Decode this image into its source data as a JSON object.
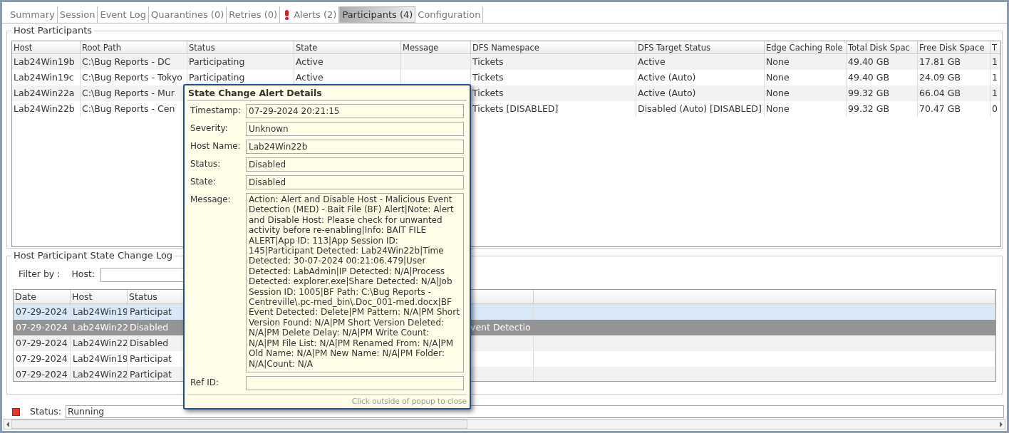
{
  "tabs": [
    {
      "label": "Summary",
      "selected": false
    },
    {
      "label": "Session",
      "selected": false
    },
    {
      "label": "Event Log",
      "selected": false
    },
    {
      "label": "Quarantines (0)",
      "selected": false
    },
    {
      "label": "Retries (0)",
      "selected": false
    },
    {
      "label": "Alerts (2)",
      "selected": false,
      "alert": true
    },
    {
      "label": "Participants (4)",
      "selected": true
    },
    {
      "label": "Configuration",
      "selected": false
    }
  ],
  "host_participants": {
    "title": "Host Participants",
    "columns": [
      "Host",
      "Root Path",
      "Status",
      "State",
      "Message",
      "DFS Namespace",
      "DFS Target Status",
      "Edge Caching Role",
      "Total Disk Spac",
      "Free Disk Space",
      "T"
    ],
    "rows": [
      {
        "host": "Lab24Win19b",
        "root_path": "C:\\Bug Reports - DC",
        "status": "Participating",
        "state": "Active",
        "dfs_namespace": "Tickets",
        "dfs_target_status": "Active",
        "edge_caching_role": "None",
        "total_disk_space": "49.40 GB",
        "free_disk_space": "17.81 GB",
        "column_11": "1"
      },
      {
        "host": "Lab24Win19c",
        "root_path": "C:\\Bug Reports - Tokyo",
        "status": "Participating",
        "state": "Active",
        "dfs_namespace": "Tickets",
        "dfs_target_status": "Active (Auto)",
        "edge_caching_role": "None",
        "total_disk_space": "49.40 GB",
        "free_disk_space": "24.09 GB",
        "column_11": "1"
      },
      {
        "host": "Lab24Win22a",
        "root_path": "C:\\Bug Reports - Mur",
        "dfs_namespace": "Tickets",
        "dfs_target_status": "Active (Auto)",
        "edge_caching_role": "None",
        "total_disk_space": "99.32 GB",
        "free_disk_space": "66.04 GB",
        "column_11": "1"
      },
      {
        "host": "Lab24Win22b",
        "root_path": "C:\\Bug Reports - Cen",
        "dfs_namespace": "Tickets [DISABLED]",
        "dfs_target_status": "Disabled (Auto) [DISABLED]",
        "edge_caching_role": "None",
        "total_disk_space": "99.32 GB",
        "free_disk_space": "70.47 GB",
        "column_11": "0"
      }
    ]
  },
  "state_change_log": {
    "title": "Host Participant State Change Log",
    "filter_label": "Filter by :",
    "host_filter_label": "Host:",
    "columns": [
      "Date",
      "Host",
      "Status"
    ],
    "rows": [
      {
        "date": "07-29-2024",
        "host": "Lab24Win19",
        "status": "Participat",
        "hovered": true,
        "selected": false
      },
      {
        "date": "07-29-2024",
        "host": "Lab24Win22",
        "status": "Disabled",
        "column_5": "vent Detectio",
        "hovered": false,
        "selected": true
      },
      {
        "date": "07-29-2024",
        "host": "Lab24Win22",
        "status": "Disabled",
        "hovered": false,
        "selected": false
      },
      {
        "date": "07-29-2024",
        "host": "Lab24Win19",
        "status": "Participat",
        "hovered": false,
        "selected": false
      },
      {
        "date": "07-29-2024",
        "host": "Lab24Win22",
        "status": "Participat",
        "hovered": false,
        "selected": false
      }
    ]
  },
  "status_bar": {
    "label": "Status:",
    "value": "Running"
  },
  "popup": {
    "title": "State Change Alert Details",
    "fields": [
      {
        "label": "Timestamp:",
        "value": "07-29-2024 20:21:15",
        "kind": "line"
      },
      {
        "label": "Severity:",
        "value": "Unknown",
        "kind": "line"
      },
      {
        "label": "Host Name:",
        "value": "Lab24Win22b",
        "kind": "line"
      },
      {
        "label": "Status:",
        "value": "Disabled",
        "kind": "line"
      },
      {
        "label": "State:",
        "value": "Disabled",
        "kind": "line"
      },
      {
        "label": "Message:",
        "value": "Action: Alert and Disable Host - Malicious Event Detection (MED) - Bait File (BF) Alert|Note: Alert and Disable Host: Please check for unwanted activity before re-enabling|Info: BAIT FILE ALERT|App ID: 113|App Session ID: 145|Participant Detected: Lab24Win22b|Time Detected: 30-07-2024 00:21:06.479|User Detected: LabAdmin|IP Detected: N/A|Process Detected: explorer.exe|Share Detected: N/A|Job Session ID: 1005|BF Path: C:\\Bug Reports - Centreville\\.pc-med_bin\\.Doc_001-med.docx|BF Event Detected: Delete|PM Pattern: N/A|PM Short Version Found: N/A|PM Short Version Deleted: N/A|PM Delete Delay: N/A|PM Write Count: N/A|PM File List: N/A|PM Renamed From: N/A|PM Old Name: N/A|PM New Name: N/A|PM Folder: N/A|Count: N/A",
        "kind": "multiline"
      },
      {
        "label": "Ref ID:",
        "kind": "line"
      }
    ],
    "hint": "Click outside of popup to close"
  }
}
